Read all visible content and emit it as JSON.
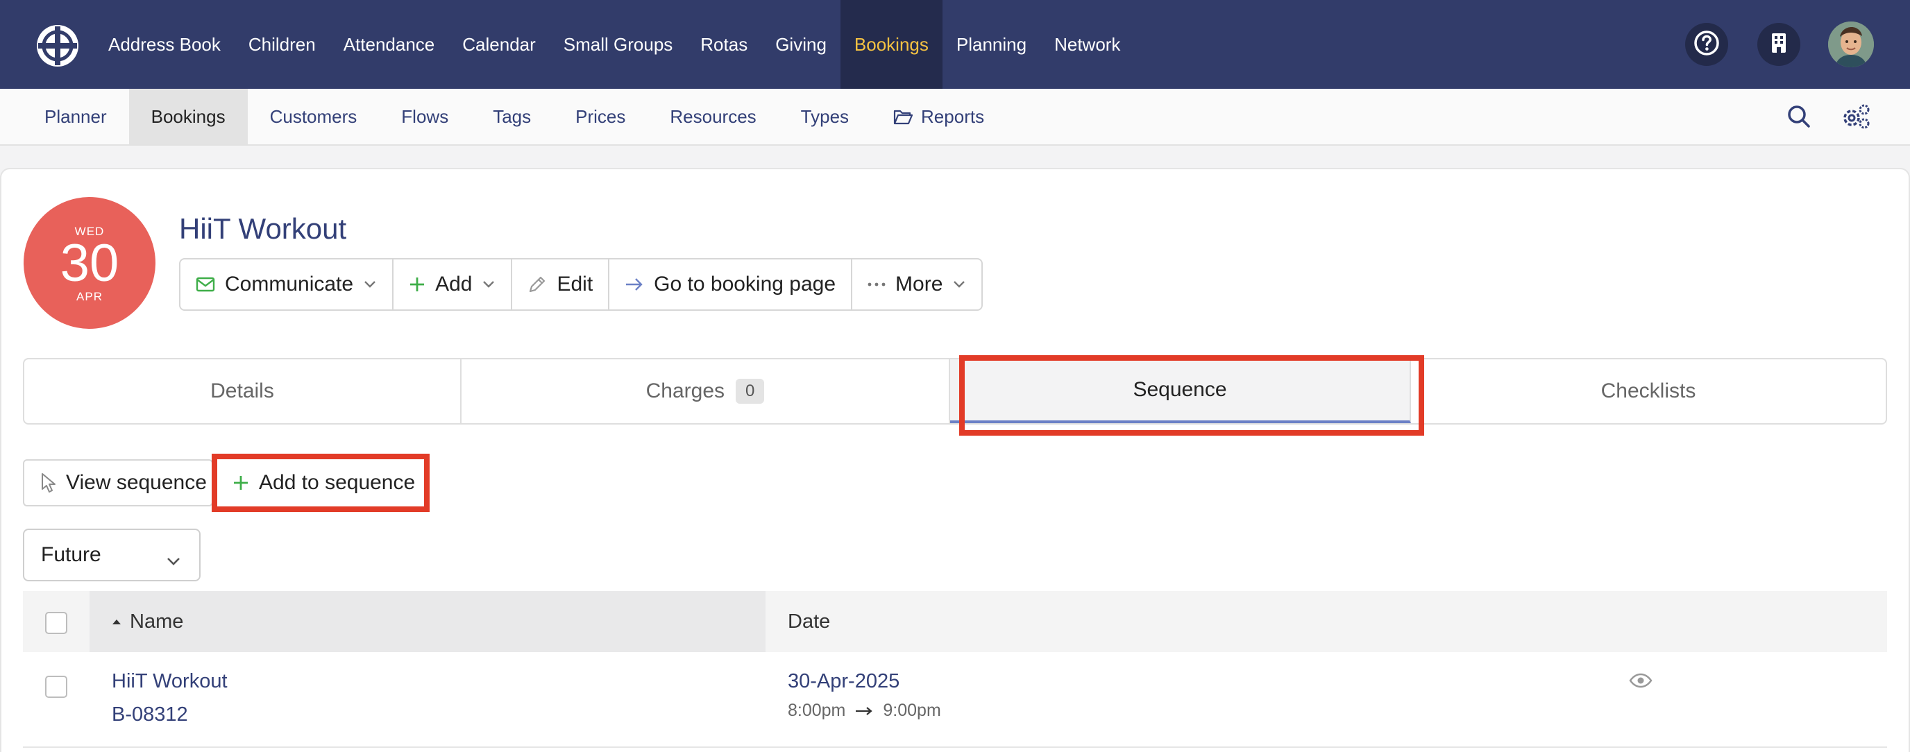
{
  "topnav": {
    "items": [
      {
        "label": "Address Book"
      },
      {
        "label": "Children"
      },
      {
        "label": "Attendance"
      },
      {
        "label": "Calendar"
      },
      {
        "label": "Small Groups"
      },
      {
        "label": "Rotas"
      },
      {
        "label": "Giving"
      },
      {
        "label": "Bookings",
        "active": true
      },
      {
        "label": "Planning"
      },
      {
        "label": "Network"
      }
    ],
    "colors": {
      "background": "#323c6a",
      "active_bg": "#242b4d",
      "active_text": "#f5c242"
    }
  },
  "subnav": {
    "items": [
      {
        "label": "Planner"
      },
      {
        "label": "Bookings",
        "active": true
      },
      {
        "label": "Customers"
      },
      {
        "label": "Flows"
      },
      {
        "label": "Tags"
      },
      {
        "label": "Prices"
      },
      {
        "label": "Resources"
      },
      {
        "label": "Types"
      },
      {
        "label": "Reports",
        "icon": "folder-open-icon"
      }
    ]
  },
  "booking": {
    "title": "HiiT Workout",
    "date_badge": {
      "dow": "WED",
      "day": "30",
      "month": "APR"
    }
  },
  "actions": {
    "communicate": "Communicate",
    "add": "Add",
    "edit": "Edit",
    "go_to_booking_page": "Go to booking page",
    "more": "More"
  },
  "tabs": [
    {
      "label": "Details"
    },
    {
      "label": "Charges",
      "count": "0"
    },
    {
      "label": "Sequence",
      "active": true
    },
    {
      "label": "Checklists"
    }
  ],
  "sequence_toolbar": {
    "view_sequence": "View sequence",
    "add_to_sequence": "Add to sequence"
  },
  "filter": {
    "selected": "Future"
  },
  "table": {
    "columns": {
      "name": "Name",
      "date": "Date"
    },
    "rows": [
      {
        "name": "HiiT Workout",
        "ref": "B-08312",
        "date": "30-Apr-2025",
        "start": "8:00pm",
        "end": "9:00pm"
      }
    ]
  },
  "colors": {
    "link": "#334078",
    "highlight": "#e23b27",
    "date_badge": "#e8615a",
    "green_icon": "#3fae49"
  }
}
